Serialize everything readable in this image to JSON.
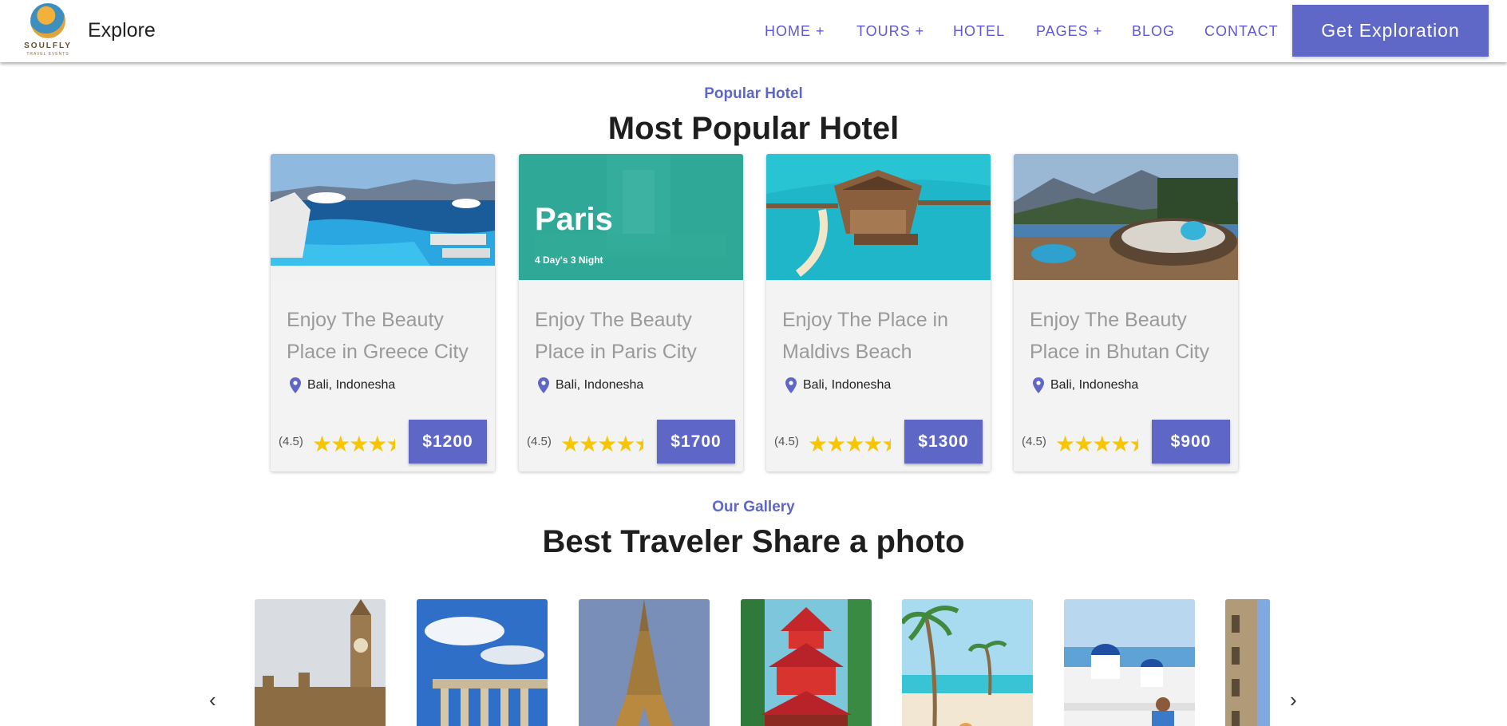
{
  "header": {
    "logo_word": "SOULFLY",
    "logo_sub": "TRAVEL EVENTS",
    "brand": "Explore",
    "nav": [
      "HOME +",
      "TOURS +",
      "HOTEL",
      "PAGES +",
      "BLOG",
      "CONTACT"
    ],
    "cta": "Get Exploration"
  },
  "popular": {
    "kicker": "Popular Hotel",
    "heading": "Most Popular Hotel",
    "cards": [
      {
        "title": "Enjoy The Beauty Place in Greece City",
        "location": "Bali, Indonesha",
        "rating": "(4.5)",
        "price": "$1200",
        "image": "greece-infinity-pool"
      },
      {
        "title": "Enjoy The Beauty Place in Paris City",
        "location": "Bali, Indonesha",
        "rating": "(4.5)",
        "price": "$1700",
        "image": "paris-overlay",
        "overlay_title": "Paris",
        "overlay_sub": "4 Day's 3 Night"
      },
      {
        "title": "Enjoy The Place in Maldivs Beach",
        "location": "Bali, Indonesha",
        "rating": "(4.5)",
        "price": "$1300",
        "image": "maldives-water-villa"
      },
      {
        "title": "Enjoy The Beauty Place in Bhutan City",
        "location": "Bali, Indonesha",
        "rating": "(4.5)",
        "price": "$900",
        "image": "bhutan-mountain-pool"
      }
    ]
  },
  "gallery": {
    "kicker": "Our Gallery",
    "heading": "Best Traveler Share a photo",
    "photos": [
      "big-ben",
      "parthenon",
      "eiffel-tower",
      "japanese-pagoda",
      "palm-beach",
      "santorini",
      "old-building"
    ]
  },
  "colors": {
    "accent": "#5e66c6",
    "nav": "#5f57d6",
    "star": "#f7c600",
    "paris_overlay": "#2fa897"
  }
}
